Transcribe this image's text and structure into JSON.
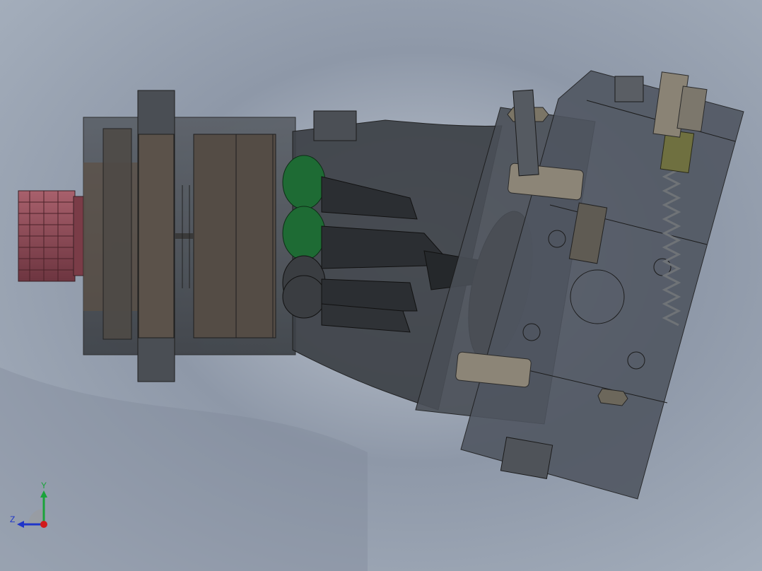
{
  "viewport": {
    "background_top": "#9aa6b8",
    "background_bottom": "#b9c2cf",
    "accent_colors": {
      "housing": "#3f4348",
      "shaft_spline": "#8a4a55",
      "pistons_green": "#1e6b34",
      "spring_olive": "#6f7040"
    }
  },
  "triad": {
    "x_label": "",
    "y_label": "Y",
    "z_label": "Z",
    "y_color": "#1aa33a",
    "z_color": "#1f35c9",
    "x_color": "#d11a1a"
  }
}
